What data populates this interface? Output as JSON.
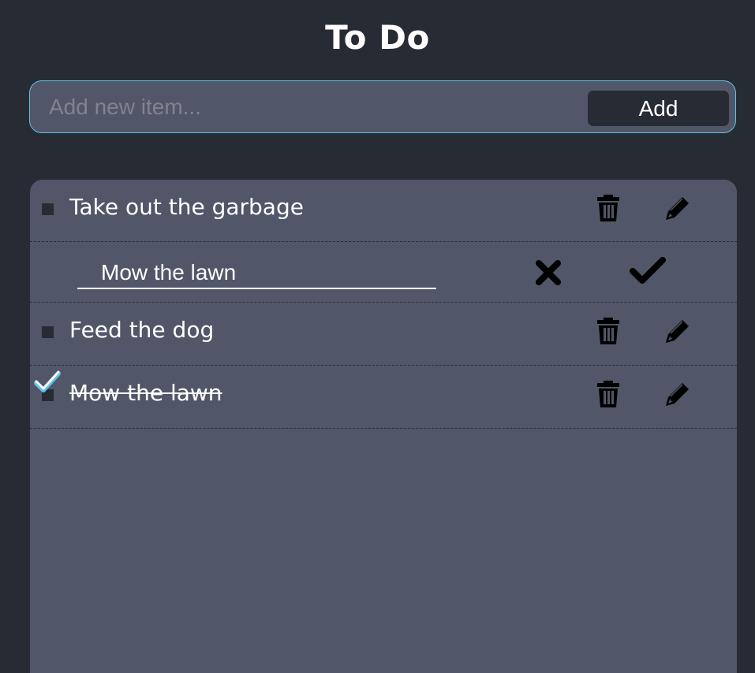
{
  "app": {
    "title": "To Do"
  },
  "add_form": {
    "placeholder": "Add new item...",
    "value": "",
    "button_label": "Add"
  },
  "items": [
    {
      "text": "Take out the garbage",
      "completed": false,
      "editing": false
    },
    {
      "text": "Mow the lawn",
      "completed": false,
      "editing": true
    },
    {
      "text": "Feed the dog",
      "completed": false,
      "editing": false
    },
    {
      "text": "Mow the lawn",
      "completed": true,
      "editing": false
    }
  ],
  "icons": {
    "delete": "trash-icon",
    "edit": "pencil-icon",
    "cancel": "close-icon",
    "confirm": "checkmark-icon",
    "done": "check-icon"
  },
  "colors": {
    "background": "#272b34",
    "panel": "#515768",
    "accent": "#5ec3e6",
    "text": "#ffffff"
  }
}
